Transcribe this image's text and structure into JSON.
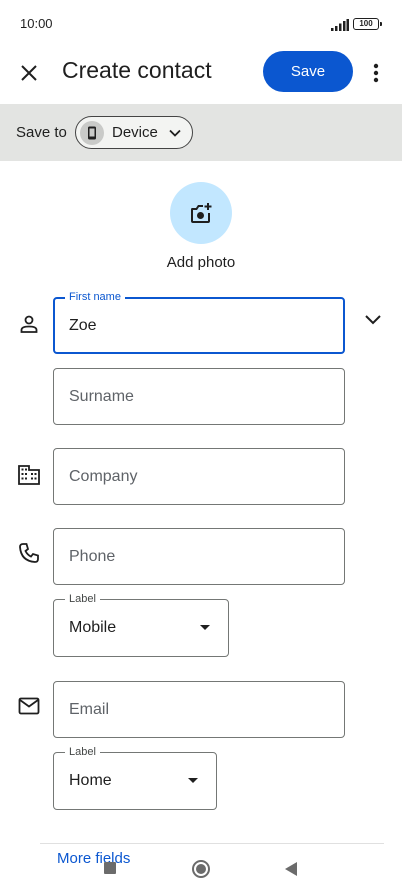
{
  "status_bar": {
    "time": "10:00",
    "battery": "100"
  },
  "header": {
    "title": "Create contact",
    "save_label": "Save",
    "close_icon": "close-icon",
    "more_icon": "more-vert-icon"
  },
  "save_to": {
    "label": "Save to",
    "device": "Device"
  },
  "photo": {
    "label": "Add photo",
    "icon": "add-camera-icon"
  },
  "fields": {
    "first_name": {
      "label": "First name",
      "value": "Zoe"
    },
    "surname": {
      "placeholder": "Surname"
    },
    "company": {
      "placeholder": "Company"
    },
    "phone": {
      "placeholder": "Phone"
    },
    "phone_label": {
      "label": "Label",
      "value": "Mobile"
    },
    "email": {
      "placeholder": "Email"
    },
    "email_label": {
      "label": "Label",
      "value": "Home"
    }
  },
  "more_fields": "More fields",
  "colors": {
    "accent": "#0b57d0",
    "photo_bg": "#c2e7ff",
    "save_to_bg": "#e3e4e2"
  }
}
